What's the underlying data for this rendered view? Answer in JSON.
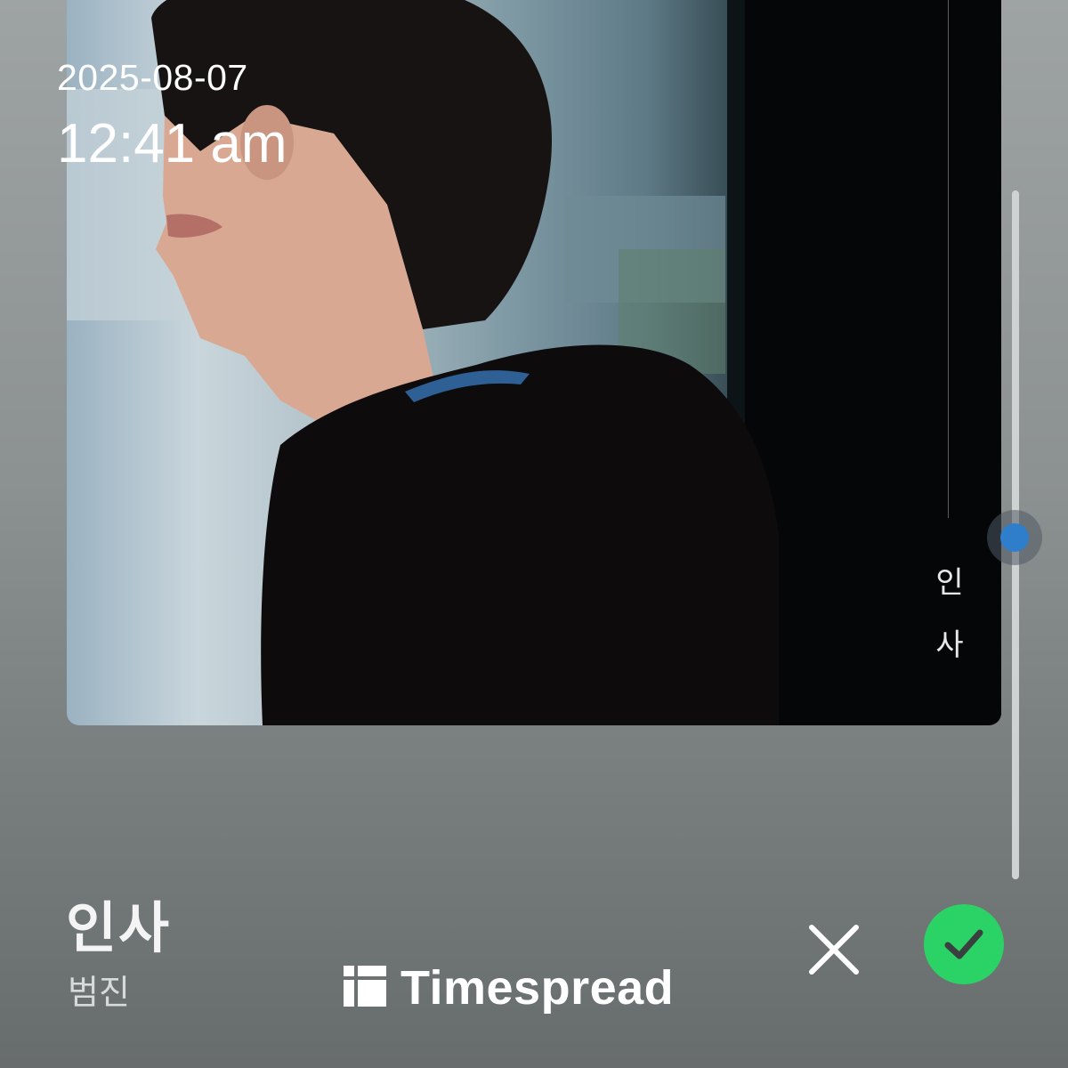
{
  "datetime": {
    "date": "2025-08-07",
    "time": "12:41 am"
  },
  "album": {
    "cover_title_chars": [
      "인",
      "사"
    ]
  },
  "track": {
    "title": "인사",
    "artist": "범진"
  },
  "brand": {
    "name": "Timespread",
    "icon": "timespread-logo-icon"
  },
  "actions": {
    "close_icon": "close-icon",
    "confirm_icon": "checkmark-icon",
    "confirm_color": "#2bd366"
  },
  "scrubber": {
    "accent_color": "#2f7ecb",
    "position_fraction": 0.5
  }
}
